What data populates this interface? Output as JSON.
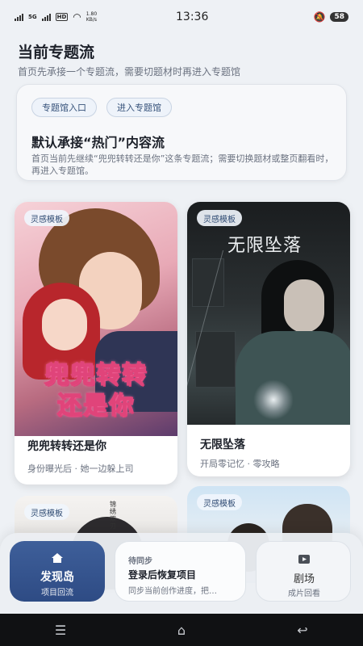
{
  "status_bar": {
    "signal_label_1": "5G",
    "hd_label": "HD",
    "speed_value": "1.80",
    "speed_unit": "KB/s",
    "time": "13:36",
    "battery": "58"
  },
  "header": {
    "title": "当前专题流",
    "subtitle": "首页先承接一个专题流，需要切题材时再进入专题馆"
  },
  "info_card": {
    "chips": [
      "专题馆入口",
      "进入专题馆"
    ],
    "headline": "默认承接“热门”内容流",
    "description": "首页当前先继续“兜兜转转还是你”这条专题流；需要切换题材或整页翻看时，再进入专题馆。"
  },
  "cards": [
    {
      "tag": "灵感模板",
      "poster_text": "兜兜转转\n还是你",
      "title": "兜兜转转还是你",
      "subtitle": "身份曝光后 · 她一边躲上司"
    },
    {
      "tag": "灵感模板",
      "poster_text": "无限坠落",
      "title": "无限坠落",
      "subtitle": "开局零记忆 · 零攻略"
    },
    {
      "tag": "灵感模板",
      "poster_text": "锦绣双刃"
    },
    {
      "tag": "灵感模板"
    }
  ],
  "dock": {
    "home": {
      "label": "发现岛",
      "sub": "项目回流",
      "icon": "home-icon"
    },
    "sync": {
      "status": "待同步",
      "title": "登录后恢复项目",
      "desc": "同步当前创作进度，把…"
    },
    "theater": {
      "label": "剧场",
      "sub": "成片回看",
      "icon": "play-box-icon"
    }
  },
  "system_nav": {
    "menu_icon": "menu-icon",
    "home_icon": "home-outline-icon",
    "back_icon": "back-icon"
  },
  "colors": {
    "accent": "#2e4b84",
    "chip_text": "#36527a",
    "background": "#eef1f5"
  }
}
